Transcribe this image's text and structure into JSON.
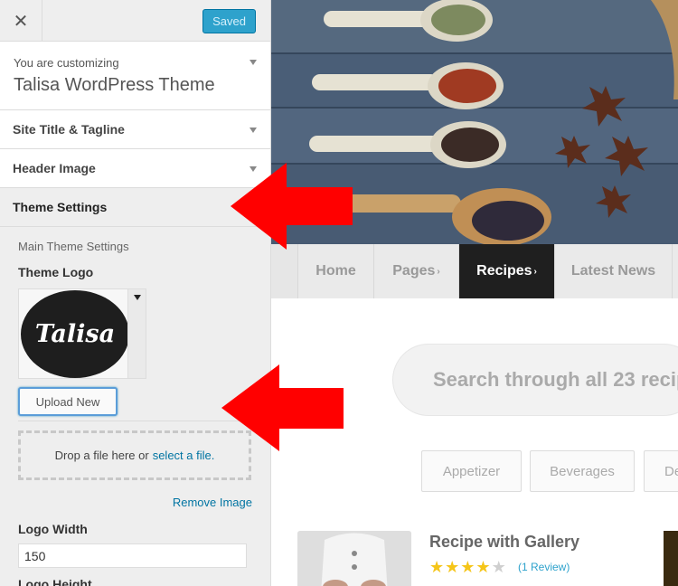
{
  "topbar": {
    "close_glyph": "✕",
    "saved_label": "Saved"
  },
  "customizing": {
    "small": "You are customizing",
    "theme": "Talisa WordPress Theme"
  },
  "sections": {
    "site_title": "Site Title & Tagline",
    "header_image": "Header Image",
    "theme_settings": "Theme Settings"
  },
  "panel": {
    "subhead": "Main Theme Settings",
    "logo_label": "Theme Logo",
    "logo_text": "Talisa",
    "upload_label": "Upload New",
    "drop_text": "Drop a file here or",
    "select_link": "select a file.",
    "remove_link": "Remove Image",
    "width_label": "Logo Width",
    "width_value": "150",
    "height_label": "Logo Height"
  },
  "nav": {
    "items": [
      "Home",
      "Pages",
      "Recipes",
      "Latest News"
    ],
    "active": "Recipes"
  },
  "search": {
    "placeholder": "Search through all 23 recip"
  },
  "categories": [
    "Appetizer",
    "Beverages",
    "De"
  ],
  "recipe": {
    "title": "Recipe with Gallery",
    "rating": 4,
    "max_rating": 5,
    "reviews": "(1 Review)"
  },
  "colors": {
    "accent": "#2ea2cc",
    "link": "#0074a2",
    "arrow": "#ff0000",
    "nav_active": "#1f1f1f"
  },
  "icons": [
    "close-icon",
    "chevron-down-icon",
    "star-icon",
    "arrow-icon"
  ]
}
